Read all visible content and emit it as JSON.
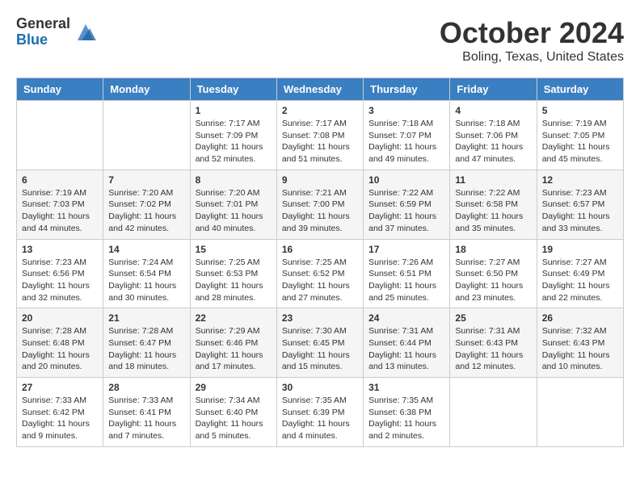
{
  "logo": {
    "general": "General",
    "blue": "Blue"
  },
  "title": "October 2024",
  "location": "Boling, Texas, United States",
  "days_of_week": [
    "Sunday",
    "Monday",
    "Tuesday",
    "Wednesday",
    "Thursday",
    "Friday",
    "Saturday"
  ],
  "weeks": [
    [
      {
        "day": "",
        "sunrise": "",
        "sunset": "",
        "daylight": ""
      },
      {
        "day": "",
        "sunrise": "",
        "sunset": "",
        "daylight": ""
      },
      {
        "day": "1",
        "sunrise": "Sunrise: 7:17 AM",
        "sunset": "Sunset: 7:09 PM",
        "daylight": "Daylight: 11 hours and 52 minutes."
      },
      {
        "day": "2",
        "sunrise": "Sunrise: 7:17 AM",
        "sunset": "Sunset: 7:08 PM",
        "daylight": "Daylight: 11 hours and 51 minutes."
      },
      {
        "day": "3",
        "sunrise": "Sunrise: 7:18 AM",
        "sunset": "Sunset: 7:07 PM",
        "daylight": "Daylight: 11 hours and 49 minutes."
      },
      {
        "day": "4",
        "sunrise": "Sunrise: 7:18 AM",
        "sunset": "Sunset: 7:06 PM",
        "daylight": "Daylight: 11 hours and 47 minutes."
      },
      {
        "day": "5",
        "sunrise": "Sunrise: 7:19 AM",
        "sunset": "Sunset: 7:05 PM",
        "daylight": "Daylight: 11 hours and 45 minutes."
      }
    ],
    [
      {
        "day": "6",
        "sunrise": "Sunrise: 7:19 AM",
        "sunset": "Sunset: 7:03 PM",
        "daylight": "Daylight: 11 hours and 44 minutes."
      },
      {
        "day": "7",
        "sunrise": "Sunrise: 7:20 AM",
        "sunset": "Sunset: 7:02 PM",
        "daylight": "Daylight: 11 hours and 42 minutes."
      },
      {
        "day": "8",
        "sunrise": "Sunrise: 7:20 AM",
        "sunset": "Sunset: 7:01 PM",
        "daylight": "Daylight: 11 hours and 40 minutes."
      },
      {
        "day": "9",
        "sunrise": "Sunrise: 7:21 AM",
        "sunset": "Sunset: 7:00 PM",
        "daylight": "Daylight: 11 hours and 39 minutes."
      },
      {
        "day": "10",
        "sunrise": "Sunrise: 7:22 AM",
        "sunset": "Sunset: 6:59 PM",
        "daylight": "Daylight: 11 hours and 37 minutes."
      },
      {
        "day": "11",
        "sunrise": "Sunrise: 7:22 AM",
        "sunset": "Sunset: 6:58 PM",
        "daylight": "Daylight: 11 hours and 35 minutes."
      },
      {
        "day": "12",
        "sunrise": "Sunrise: 7:23 AM",
        "sunset": "Sunset: 6:57 PM",
        "daylight": "Daylight: 11 hours and 33 minutes."
      }
    ],
    [
      {
        "day": "13",
        "sunrise": "Sunrise: 7:23 AM",
        "sunset": "Sunset: 6:56 PM",
        "daylight": "Daylight: 11 hours and 32 minutes."
      },
      {
        "day": "14",
        "sunrise": "Sunrise: 7:24 AM",
        "sunset": "Sunset: 6:54 PM",
        "daylight": "Daylight: 11 hours and 30 minutes."
      },
      {
        "day": "15",
        "sunrise": "Sunrise: 7:25 AM",
        "sunset": "Sunset: 6:53 PM",
        "daylight": "Daylight: 11 hours and 28 minutes."
      },
      {
        "day": "16",
        "sunrise": "Sunrise: 7:25 AM",
        "sunset": "Sunset: 6:52 PM",
        "daylight": "Daylight: 11 hours and 27 minutes."
      },
      {
        "day": "17",
        "sunrise": "Sunrise: 7:26 AM",
        "sunset": "Sunset: 6:51 PM",
        "daylight": "Daylight: 11 hours and 25 minutes."
      },
      {
        "day": "18",
        "sunrise": "Sunrise: 7:27 AM",
        "sunset": "Sunset: 6:50 PM",
        "daylight": "Daylight: 11 hours and 23 minutes."
      },
      {
        "day": "19",
        "sunrise": "Sunrise: 7:27 AM",
        "sunset": "Sunset: 6:49 PM",
        "daylight": "Daylight: 11 hours and 22 minutes."
      }
    ],
    [
      {
        "day": "20",
        "sunrise": "Sunrise: 7:28 AM",
        "sunset": "Sunset: 6:48 PM",
        "daylight": "Daylight: 11 hours and 20 minutes."
      },
      {
        "day": "21",
        "sunrise": "Sunrise: 7:28 AM",
        "sunset": "Sunset: 6:47 PM",
        "daylight": "Daylight: 11 hours and 18 minutes."
      },
      {
        "day": "22",
        "sunrise": "Sunrise: 7:29 AM",
        "sunset": "Sunset: 6:46 PM",
        "daylight": "Daylight: 11 hours and 17 minutes."
      },
      {
        "day": "23",
        "sunrise": "Sunrise: 7:30 AM",
        "sunset": "Sunset: 6:45 PM",
        "daylight": "Daylight: 11 hours and 15 minutes."
      },
      {
        "day": "24",
        "sunrise": "Sunrise: 7:31 AM",
        "sunset": "Sunset: 6:44 PM",
        "daylight": "Daylight: 11 hours and 13 minutes."
      },
      {
        "day": "25",
        "sunrise": "Sunrise: 7:31 AM",
        "sunset": "Sunset: 6:43 PM",
        "daylight": "Daylight: 11 hours and 12 minutes."
      },
      {
        "day": "26",
        "sunrise": "Sunrise: 7:32 AM",
        "sunset": "Sunset: 6:43 PM",
        "daylight": "Daylight: 11 hours and 10 minutes."
      }
    ],
    [
      {
        "day": "27",
        "sunrise": "Sunrise: 7:33 AM",
        "sunset": "Sunset: 6:42 PM",
        "daylight": "Daylight: 11 hours and 9 minutes."
      },
      {
        "day": "28",
        "sunrise": "Sunrise: 7:33 AM",
        "sunset": "Sunset: 6:41 PM",
        "daylight": "Daylight: 11 hours and 7 minutes."
      },
      {
        "day": "29",
        "sunrise": "Sunrise: 7:34 AM",
        "sunset": "Sunset: 6:40 PM",
        "daylight": "Daylight: 11 hours and 5 minutes."
      },
      {
        "day": "30",
        "sunrise": "Sunrise: 7:35 AM",
        "sunset": "Sunset: 6:39 PM",
        "daylight": "Daylight: 11 hours and 4 minutes."
      },
      {
        "day": "31",
        "sunrise": "Sunrise: 7:35 AM",
        "sunset": "Sunset: 6:38 PM",
        "daylight": "Daylight: 11 hours and 2 minutes."
      },
      {
        "day": "",
        "sunrise": "",
        "sunset": "",
        "daylight": ""
      },
      {
        "day": "",
        "sunrise": "",
        "sunset": "",
        "daylight": ""
      }
    ]
  ]
}
